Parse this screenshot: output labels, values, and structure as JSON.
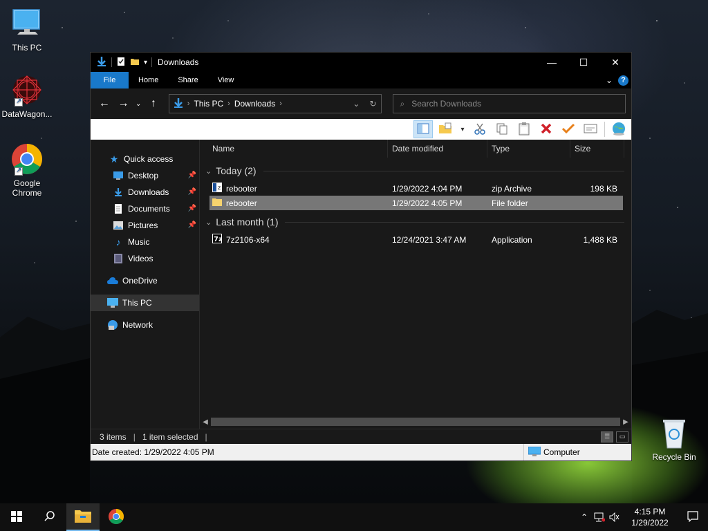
{
  "desktop": {
    "icons": [
      {
        "label": "This PC",
        "icon": "monitor-icon"
      },
      {
        "label": "DataWagon...",
        "icon": "datawagon-icon"
      },
      {
        "label": "Google Chrome",
        "icon": "chrome-icon"
      },
      {
        "label": "Recycle Bin",
        "icon": "recycle-bin-icon"
      }
    ]
  },
  "window": {
    "title": "Downloads",
    "ribbon_tabs": [
      "File",
      "Home",
      "Share",
      "View"
    ],
    "help_label": "?",
    "address": {
      "crumbs": [
        "This PC",
        "Downloads"
      ]
    },
    "search": {
      "placeholder": "Search Downloads"
    }
  },
  "nav_pane": {
    "quick_access": "Quick access",
    "items": [
      {
        "label": "Desktop",
        "pinned": true
      },
      {
        "label": "Downloads",
        "pinned": true
      },
      {
        "label": "Documents",
        "pinned": true
      },
      {
        "label": "Pictures",
        "pinned": true
      },
      {
        "label": "Music",
        "pinned": false
      },
      {
        "label": "Videos",
        "pinned": false
      }
    ],
    "onedrive": "OneDrive",
    "this_pc": "This PC",
    "network": "Network"
  },
  "file_list": {
    "columns": [
      "Name",
      "Date modified",
      "Type",
      "Size"
    ],
    "groups": [
      {
        "label": "Today (2)",
        "rows": [
          {
            "name": "rebooter",
            "date": "1/29/2022 4:04 PM",
            "type": "zip Archive",
            "size": "198 KB",
            "icon": "zip-archive-icon"
          },
          {
            "name": "rebooter",
            "date": "1/29/2022 4:05 PM",
            "type": "File folder",
            "size": "",
            "icon": "folder-icon"
          }
        ]
      },
      {
        "label": "Last month (1)",
        "rows": [
          {
            "name": "7z2106-x64",
            "date": "12/24/2021 3:47 AM",
            "type": "Application",
            "size": "1,488 KB",
            "icon": "7zip-icon"
          }
        ]
      }
    ]
  },
  "status": {
    "items_count": "3 items",
    "selection": "1 item selected"
  },
  "details_bar": {
    "date_created": "Date created: 1/29/2022 4:05 PM",
    "location": "Computer"
  },
  "taskbar": {
    "time": "4:15 PM",
    "date": "1/29/2022"
  },
  "colors": {
    "accent": "#1979ca",
    "window_bg": "#191919",
    "selected_row": "#777777"
  }
}
